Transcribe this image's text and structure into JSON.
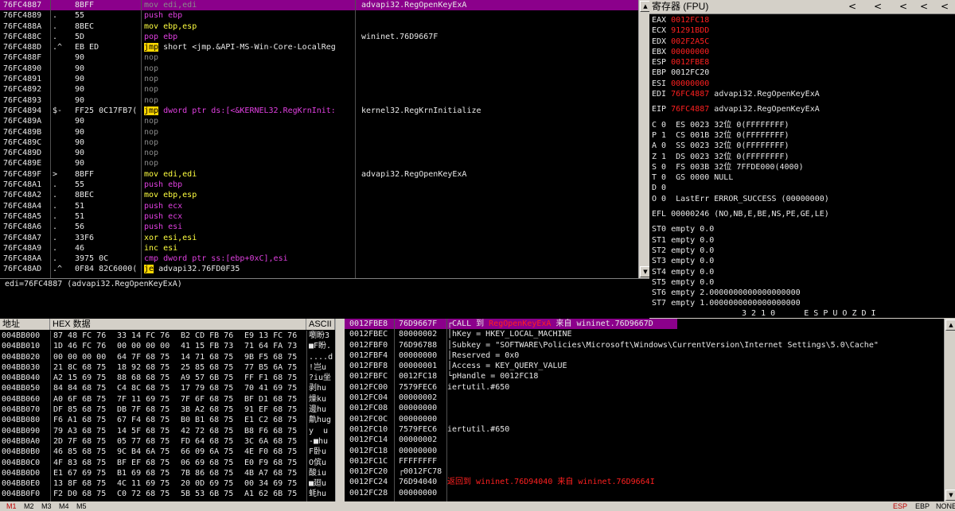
{
  "disasm": {
    "rows": [
      {
        "addr": "76FC4887",
        "m": "",
        "hex": "8BFF",
        "instr": "mov edi,edi",
        "icls": "gray",
        "cmt": "advapi32.RegOpenKeyExA",
        "sel": true
      },
      {
        "addr": "76FC4889",
        "m": ".",
        "hex": "55",
        "instr": "push ebp",
        "icls": "mag",
        "cmt": ""
      },
      {
        "addr": "76FC488A",
        "m": ".",
        "hex": "8BEC",
        "instr": "mov ebp,esp",
        "icls": "yel",
        "cmt": ""
      },
      {
        "addr": "76FC488C",
        "m": ".",
        "hex": "5D",
        "instr": "pop ebp",
        "icls": "mag",
        "cmt": "wininet.76D9667F"
      },
      {
        "addr": "76FC488D",
        "m": ".^",
        "hex": "EB ED",
        "jmp": "jmp",
        "instr": " short <jmp.&API-MS-Win-Core-LocalReg",
        "icls": "white",
        "cmt": ""
      },
      {
        "addr": "76FC488F",
        "m": "",
        "hex": "90",
        "instr": "nop",
        "icls": "gray",
        "cmt": ""
      },
      {
        "addr": "76FC4890",
        "m": "",
        "hex": "90",
        "instr": "nop",
        "icls": "gray",
        "cmt": ""
      },
      {
        "addr": "76FC4891",
        "m": "",
        "hex": "90",
        "instr": "nop",
        "icls": "gray",
        "cmt": ""
      },
      {
        "addr": "76FC4892",
        "m": "",
        "hex": "90",
        "instr": "nop",
        "icls": "gray",
        "cmt": ""
      },
      {
        "addr": "76FC4893",
        "m": "",
        "hex": "90",
        "instr": "nop",
        "icls": "gray",
        "cmt": ""
      },
      {
        "addr": "76FC4894",
        "m": "$-",
        "hex": "FF25 0C17FB7(",
        "jmp": "jmp",
        "instr": " dword ptr ds:[<&KERNEL32.RegKrnInit:",
        "icls": "mag",
        "cmt": "kernel32.RegKrnInitialize"
      },
      {
        "addr": "76FC489A",
        "m": "",
        "hex": "90",
        "instr": "nop",
        "icls": "gray",
        "cmt": ""
      },
      {
        "addr": "76FC489B",
        "m": "",
        "hex": "90",
        "instr": "nop",
        "icls": "gray",
        "cmt": ""
      },
      {
        "addr": "76FC489C",
        "m": "",
        "hex": "90",
        "instr": "nop",
        "icls": "gray",
        "cmt": ""
      },
      {
        "addr": "76FC489D",
        "m": "",
        "hex": "90",
        "instr": "nop",
        "icls": "gray",
        "cmt": ""
      },
      {
        "addr": "76FC489E",
        "m": "",
        "hex": "90",
        "instr": "nop",
        "icls": "gray",
        "cmt": ""
      },
      {
        "addr": "76FC489F",
        "m": ">",
        "hex": "8BFF",
        "instr": "mov edi,edi",
        "icls": "yel",
        "cmt": "advapi32.RegOpenKeyExA"
      },
      {
        "addr": "76FC48A1",
        "m": ".",
        "hex": "55",
        "instr": "push ebp",
        "icls": "mag",
        "cmt": ""
      },
      {
        "addr": "76FC48A2",
        "m": ".",
        "hex": "8BEC",
        "instr": "mov ebp,esp",
        "icls": "yel",
        "cmt": ""
      },
      {
        "addr": "76FC48A4",
        "m": ".",
        "hex": "51",
        "instr": "push ecx",
        "icls": "mag",
        "cmt": ""
      },
      {
        "addr": "76FC48A5",
        "m": ".",
        "hex": "51",
        "instr": "push ecx",
        "icls": "mag",
        "cmt": ""
      },
      {
        "addr": "76FC48A6",
        "m": ".",
        "hex": "56",
        "instr": "push esi",
        "icls": "mag",
        "cmt": ""
      },
      {
        "addr": "76FC48A7",
        "m": ".",
        "hex": "33F6",
        "instr": "xor esi,esi",
        "icls": "yel",
        "cmt": ""
      },
      {
        "addr": "76FC48A9",
        "m": ".",
        "hex": "46",
        "instr": "inc esi",
        "icls": "yel",
        "cmt": ""
      },
      {
        "addr": "76FC48AA",
        "m": ".",
        "hex": "3975 0C",
        "instr": "cmp dword ptr ss:[ebp+0xC],esi",
        "icls": "mag",
        "cmt": ""
      },
      {
        "addr": "76FC48AD",
        "m": ".^",
        "hex": "0F84 82C6000(",
        "jmp": "je",
        "instr": " advapi32.76FD0F35",
        "icls": "white",
        "cmt": ""
      }
    ]
  },
  "info_line": "edi=76FC4887 (advapi32.RegOpenKeyExA)",
  "registers": {
    "title": "寄存器 (FPU)",
    "nav": [
      "<",
      "<",
      "<",
      "<",
      "<"
    ],
    "gpr": [
      {
        "n": "EAX",
        "v": "0012FC18",
        "c": "red",
        "d": ""
      },
      {
        "n": "ECX",
        "v": "91291BDD",
        "c": "red",
        "d": ""
      },
      {
        "n": "EDX",
        "v": "002F2A5C",
        "c": "red",
        "d": ""
      },
      {
        "n": "EBX",
        "v": "00000000",
        "c": "red",
        "d": ""
      },
      {
        "n": "ESP",
        "v": "0012FBE8",
        "c": "red",
        "d": ""
      },
      {
        "n": "EBP",
        "v": "0012FC20",
        "c": "white",
        "d": ""
      },
      {
        "n": "ESI",
        "v": "00000000",
        "c": "red",
        "d": ""
      },
      {
        "n": "EDI",
        "v": "76FC4887",
        "c": "red",
        "d": "advapi32.RegOpenKeyExA"
      }
    ],
    "eip": {
      "n": "EIP",
      "v": "76FC4887",
      "d": "advapi32.RegOpenKeyExA"
    },
    "flags": [
      "C 0  ES 0023 32位 0(FFFFFFFF)",
      "P 1  CS 001B 32位 0(FFFFFFFF)",
      "A 0  SS 0023 32位 0(FFFFFFFF)",
      "Z 1  DS 0023 32位 0(FFFFFFFF)",
      "S 0  FS 003B 32位 7FFDE000(4000)",
      "T 0  GS 0000 NULL",
      "D 0",
      "O 0  LastErr ERROR_SUCCESS (00000000)"
    ],
    "efl": "EFL 00000246 (NO,NB,E,BE,NS,PE,GE,LE)",
    "fpu": [
      "ST0 empty 0.0",
      "ST1 empty 0.0",
      "ST2 empty 0.0",
      "ST3 empty 0.0",
      "ST4 empty 0.0",
      "ST5 empty 0.0",
      "ST6 empty 2.0000000000000000000",
      "ST7 empty 1.0000000000000000000"
    ],
    "fpu_tail": "3 2 1 0      E S P U O Z D I"
  },
  "dump": {
    "col_addr": "地址",
    "col_hex": "HEX 数据",
    "col_ascii": "ASCII",
    "rows": [
      {
        "a": "004BB000",
        "h1": "87 48 FC 76",
        "h2": "33 14 FC 76",
        "h3": "B2 CD FB 76",
        "h4": "E9 13 FC 76",
        "s": "嚠盼3"
      },
      {
        "a": "004BB010",
        "h1": "1D 46 FC 76",
        "h2": "00 00 00 00",
        "h3": "41 15 FB 73",
        "h4": "71 64 FA 73",
        "s": "■F盼."
      },
      {
        "a": "004BB020",
        "h1": "00 00 00 00",
        "h2": "64 7F 68 75",
        "h3": "14 71 68 75",
        "h4": "9B F5 68 75",
        "s": "....d"
      },
      {
        "a": "004BB030",
        "h1": "21 8C 68 75",
        "h2": "18 92 68 75",
        "h3": "25 85 68 75",
        "h4": "77 B5 6A 75",
        "s": "!岂u"
      },
      {
        "a": "004BB040",
        "h1": "A2 15 69 75",
        "h2": "88 68 68 75",
        "h3": "A9 57 6B 75",
        "h4": "FF F1 68 75",
        "s": "?iu坐"
      },
      {
        "a": "004BB050",
        "h1": "84 84 68 75",
        "h2": "C4 8C 68 75",
        "h3": "17 79 68 75",
        "h4": "70 41 69 75",
        "s": "剥hu"
      },
      {
        "a": "004BB060",
        "h1": "A0 6F 6B 75",
        "h2": "7F 11 69 75",
        "h3": "7F 6F 68 75",
        "h4": "BF D1 68 75",
        "s": "燥ku"
      },
      {
        "a": "004BB070",
        "h1": "DF 85 68 75",
        "h2": "DB 7F 68 75",
        "h3": "3B A2 68 75",
        "h4": "91 EF 68 75",
        "s": "邊hu"
      },
      {
        "a": "004BB080",
        "h1": "F6 A1 68 75",
        "h2": "67 F4 68 75",
        "h3": "B0 B1 68 75",
        "h4": "E1 C2 68 75",
        "s": "鼽hug"
      },
      {
        "a": "004BB090",
        "h1": "79 A3 68 75",
        "h2": "14 5F 68 75",
        "h3": "42 72 68 75",
        "h4": "B8 F6 68 75",
        "s": "y  u"
      },
      {
        "a": "004BB0A0",
        "h1": "2D 7F 68 75",
        "h2": "05 77 68 75",
        "h3": "FD 64 68 75",
        "h4": "3C 6A 68 75",
        "s": "-■hu"
      },
      {
        "a": "004BB0B0",
        "h1": "46 85 68 75",
        "h2": "9C B4 6A 75",
        "h3": "66 09 6A 75",
        "h4": "4E F0 68 75",
        "s": "F卧u"
      },
      {
        "a": "004BB0C0",
        "h1": "4F 83 68 75",
        "h2": "BF EF 68 75",
        "h3": "06 69 68 75",
        "h4": "E0 F9 68 75",
        "s": "O傧u"
      },
      {
        "a": "004BB0D0",
        "h1": "E1 67 69 75",
        "h2": "B1 69 68 75",
        "h3": "7B 86 68 75",
        "h4": "4B A7 68 75",
        "s": "酸iu"
      },
      {
        "a": "004BB0E0",
        "h1": "13 8F 68 75",
        "h2": "4C 11 69 75",
        "h3": "20 0D 69 75",
        "h4": "00 34 69 75",
        "s": "■廻u"
      },
      {
        "a": "004BB0F0",
        "h1": "F2 D0 68 75",
        "h2": "C0 72 68 75",
        "h3": "5B 53 6B 75",
        "h4": "A1 62 6B 75",
        "s": "蚝hu"
      }
    ]
  },
  "stack": {
    "rows": [
      {
        "a": "0012FBE8",
        "v": "76D9667F",
        "box": "┌",
        "t": "CALL 到 ",
        "n": "RegOpenKeyExA",
        "t2": " 来自 ",
        "n2": "wininet.76D9667D",
        "sel": true
      },
      {
        "a": "0012FBEC",
        "v": "80000002",
        "box": "│",
        "t": "hKey = HKEY_LOCAL_MACHINE"
      },
      {
        "a": "0012FBF0",
        "v": "76D96788",
        "box": "│",
        "t": "Subkey = \"SOFTWARE\\Policies\\Microsoft\\Windows\\CurrentVersion\\Internet Settings\\5.0\\Cache\""
      },
      {
        "a": "0012FBF4",
        "v": "00000000",
        "box": "│",
        "t": "Reserved = 0x0"
      },
      {
        "a": "0012FBF8",
        "v": "00000001",
        "box": "│",
        "t": "Access = KEY_QUERY_VALUE"
      },
      {
        "a": "0012FBFC",
        "v": "0012FC18",
        "box": "└",
        "t": "pHandle = 0012FC18"
      },
      {
        "a": "0012FC00",
        "v": "7579FEC6",
        "box": "",
        "t": "iertutil.#650"
      },
      {
        "a": "0012FC04",
        "v": "00000002",
        "box": "",
        "t": ""
      },
      {
        "a": "0012FC08",
        "v": "00000000",
        "box": "",
        "t": ""
      },
      {
        "a": "0012FC0C",
        "v": "00000000",
        "box": "",
        "t": ""
      },
      {
        "a": "0012FC10",
        "v": "7579FEC6",
        "box": "",
        "t": "iertutil.#650"
      },
      {
        "a": "0012FC14",
        "v": "00000002",
        "box": "",
        "t": ""
      },
      {
        "a": "0012FC18",
        "v": "00000000",
        "box": "",
        "t": ""
      },
      {
        "a": "0012FC1C",
        "v": "FFFFFFFF",
        "box": "",
        "t": ""
      },
      {
        "a": "0012FC20",
        "v": "┌0012FC78",
        "box": "",
        "t": ""
      },
      {
        "a": "0012FC24",
        "v": "76D94040",
        "box": "",
        "ret": "返回到 wininet.76D94040 来自 wininet.76D9664I"
      },
      {
        "a": "0012FC28",
        "v": "00000000",
        "box": "",
        "t": ""
      }
    ]
  },
  "tabs": [
    "M1",
    "M2",
    "M3",
    "M4",
    "M5"
  ],
  "status_right": [
    "ESP",
    "EBP",
    "NONE"
  ]
}
